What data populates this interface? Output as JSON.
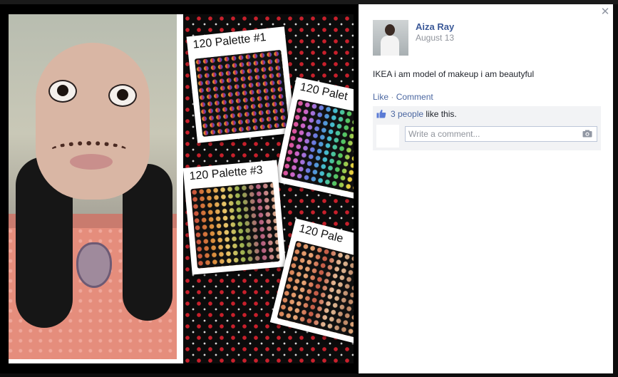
{
  "photos": {
    "palette_labels": [
      "120 Palette #1",
      "120 Palet",
      "120 Palette #3",
      "120 Pale"
    ]
  },
  "post": {
    "author": "Aiza Ray",
    "date": "August 13",
    "caption": "IKEA i am model of makeup i am beautyful"
  },
  "actions": {
    "like": "Like",
    "separator": "·",
    "comment": "Comment"
  },
  "likes": {
    "count_link": "3 people",
    "suffix": " like this."
  },
  "comment_box": {
    "placeholder": "Write a comment..."
  },
  "icons": [
    "close-icon",
    "like-thumb-icon",
    "camera-icon"
  ],
  "colors": {
    "link": "#4b67a1",
    "name": "#3b5998",
    "ufi_background": "#f2f3f5"
  }
}
